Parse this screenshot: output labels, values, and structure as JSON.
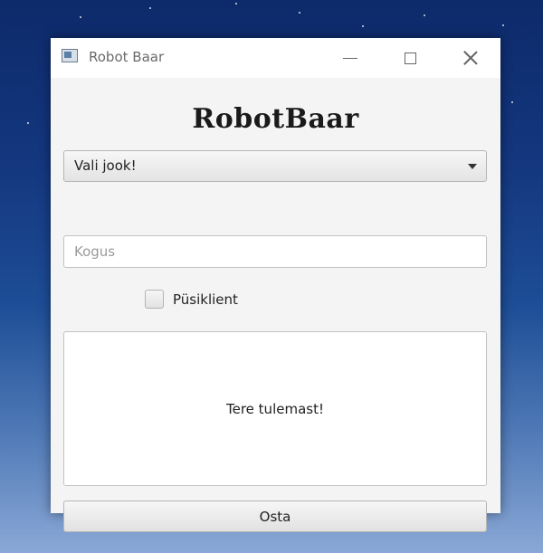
{
  "window": {
    "title": "Robot Baar",
    "icons": {
      "app": "app-window-icon",
      "minimize": "minimize-icon",
      "maximize": "maximize-icon",
      "close": "close-icon"
    }
  },
  "main": {
    "heading": "RobotBaar",
    "drink_select": {
      "selected": "Vali jook!",
      "icon": "chevron-down-icon"
    },
    "quantity_input": {
      "value": "",
      "placeholder": "Kogus"
    },
    "regular_customer": {
      "label": "Püsiklient",
      "checked": false
    },
    "message": "Tere tulemast!",
    "buy_button_label": "Osta"
  },
  "colors": {
    "window_bg": "#f4f4f4",
    "titlebar_bg": "#ffffff",
    "desktop_top": "#0d2a6a",
    "desktop_bottom": "#8aa8d6"
  }
}
